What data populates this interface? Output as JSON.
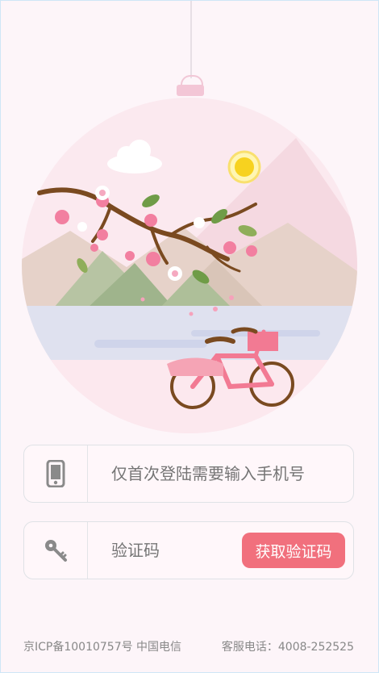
{
  "status_bar": {
    "text": ""
  },
  "illustration": {
    "theme": "cherry-blossom-bicycle-ornament"
  },
  "phone_field": {
    "icon": "phone-icon",
    "placeholder": "仅首次登陆需要输入手机号"
  },
  "code_field": {
    "icon": "key-icon",
    "placeholder": "验证码",
    "get_code_label": "获取验证码"
  },
  "footer": {
    "icp": "京ICP备10010757号 中国电信",
    "hotline": "客服电话：4008-252525"
  },
  "colors": {
    "accent": "#f1707d",
    "background": "#fdf5f9",
    "border": "#dfe2e6"
  }
}
